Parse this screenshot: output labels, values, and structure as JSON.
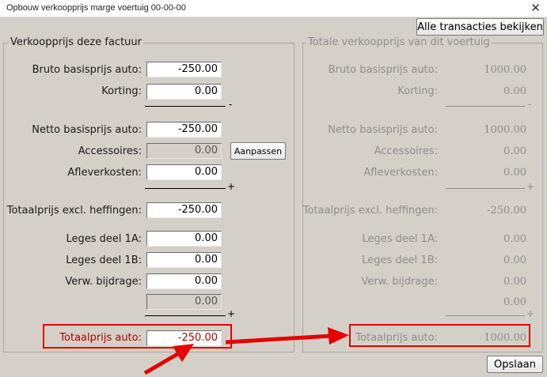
{
  "window": {
    "title": "Opbouw verkoopprijs marge voertuig 00-00-00",
    "close_glyph": "✕"
  },
  "buttons": {
    "all_transactions": "Alle transacties bekijken",
    "adjust": "Aanpassen",
    "save": "Opslaan"
  },
  "left": {
    "legend": "Verkoopprijs deze factuur",
    "labels": {
      "bruto": "Bruto basisprijs auto:",
      "korting": "Korting:",
      "netto": "Netto basisprijs auto:",
      "accessoires": "Accessoires:",
      "afleverkosten": "Afleverkosten:",
      "totaal_excl": "Totaalprijs excl. heffingen:",
      "leges_1a": "Leges deel 1A:",
      "leges_1b": "Leges deel 1B:",
      "verw": "Verw. bijdrage:",
      "totaal_auto": "Totaalprijs auto:"
    },
    "values": {
      "bruto": "-250.00",
      "korting": "0.00",
      "netto": "-250.00",
      "accessoires": "0.00",
      "afleverkosten": "0.00",
      "totaal_excl": "-250.00",
      "leges_1a": "0.00",
      "leges_1b": "0.00",
      "verw": "0.00",
      "subtotal": "0.00",
      "totaal_auto": "-250.00"
    },
    "ops": {
      "minus": "-",
      "plus1": "+",
      "plus2": "+"
    }
  },
  "right": {
    "legend": "Totale verkoopprijs van dit voertuig",
    "labels": {
      "bruto": "Bruto basisprijs auto:",
      "korting": "Korting:",
      "netto": "Netto basisprijs auto:",
      "accessoires": "Accessoires:",
      "afleverkosten": "Afleverkosten:",
      "totaal_excl": "Totaalprijs excl. heffingen:",
      "leges_1a": "Leges deel 1A:",
      "leges_1b": "Leges deel 1B:",
      "verw": "Verw. bijdrage:",
      "totaal_auto": "Totaalprijs auto:"
    },
    "values": {
      "bruto": "1000.00",
      "korting": "0.00",
      "netto": "1000.00",
      "accessoires": "0.00",
      "afleverkosten": "0.00",
      "totaal_excl": "-250.00",
      "leges_1a": "0.00",
      "leges_1b": "0.00",
      "verw": "0.00",
      "subtotal": "0.00",
      "totaal_auto": "1000.00"
    },
    "ops": {
      "minus": "-",
      "plus1": "+",
      "plus2": "+"
    }
  },
  "colors": {
    "annotation": "#e60000",
    "background": "#d4d0c8",
    "red_label": "#b30000"
  }
}
